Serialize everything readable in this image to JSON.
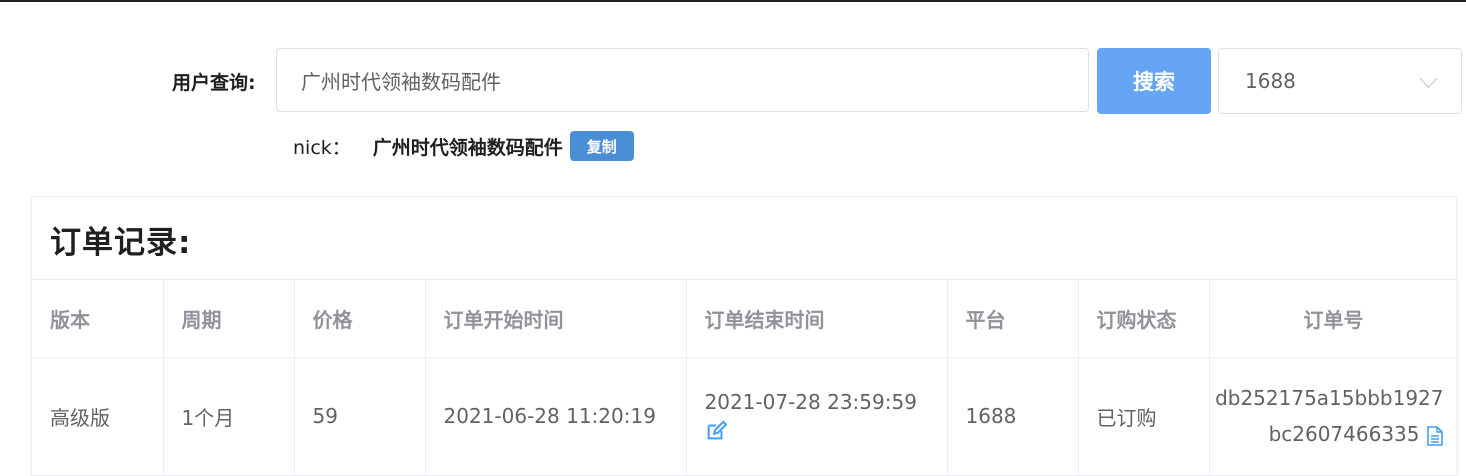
{
  "search": {
    "label": "用户查询:",
    "value": "广州时代领袖数码配件",
    "button_label": "搜索",
    "platform_selected": "1688"
  },
  "nick": {
    "key": "nick：",
    "value": "广州时代领袖数码配件",
    "copy_label": "复制"
  },
  "orders": {
    "title": "订单记录:",
    "columns": [
      "版本",
      "周期",
      "价格",
      "订单开始时间",
      "订单结束时间",
      "平台",
      "订购状态",
      "订单号"
    ],
    "rows": [
      {
        "version": "高级版",
        "period": "1个月",
        "price": "59",
        "start": "2021-06-28 11:20:19",
        "end": "2021-07-28 23:59:59",
        "platform": "1688",
        "status": "已订购",
        "order_no_line1": "db252175a15bbb1927",
        "order_no_line2": "bc2607466335"
      }
    ]
  },
  "icons": {
    "chevron": "chevron-down-icon",
    "edit": "edit-icon",
    "copy_doc": "document-copy-icon"
  },
  "colors": {
    "primary_button": "#66a5f5",
    "copy_button": "#4a8fd6",
    "icon_blue": "#409eff",
    "header_text": "#909399",
    "cell_text": "#606266"
  }
}
